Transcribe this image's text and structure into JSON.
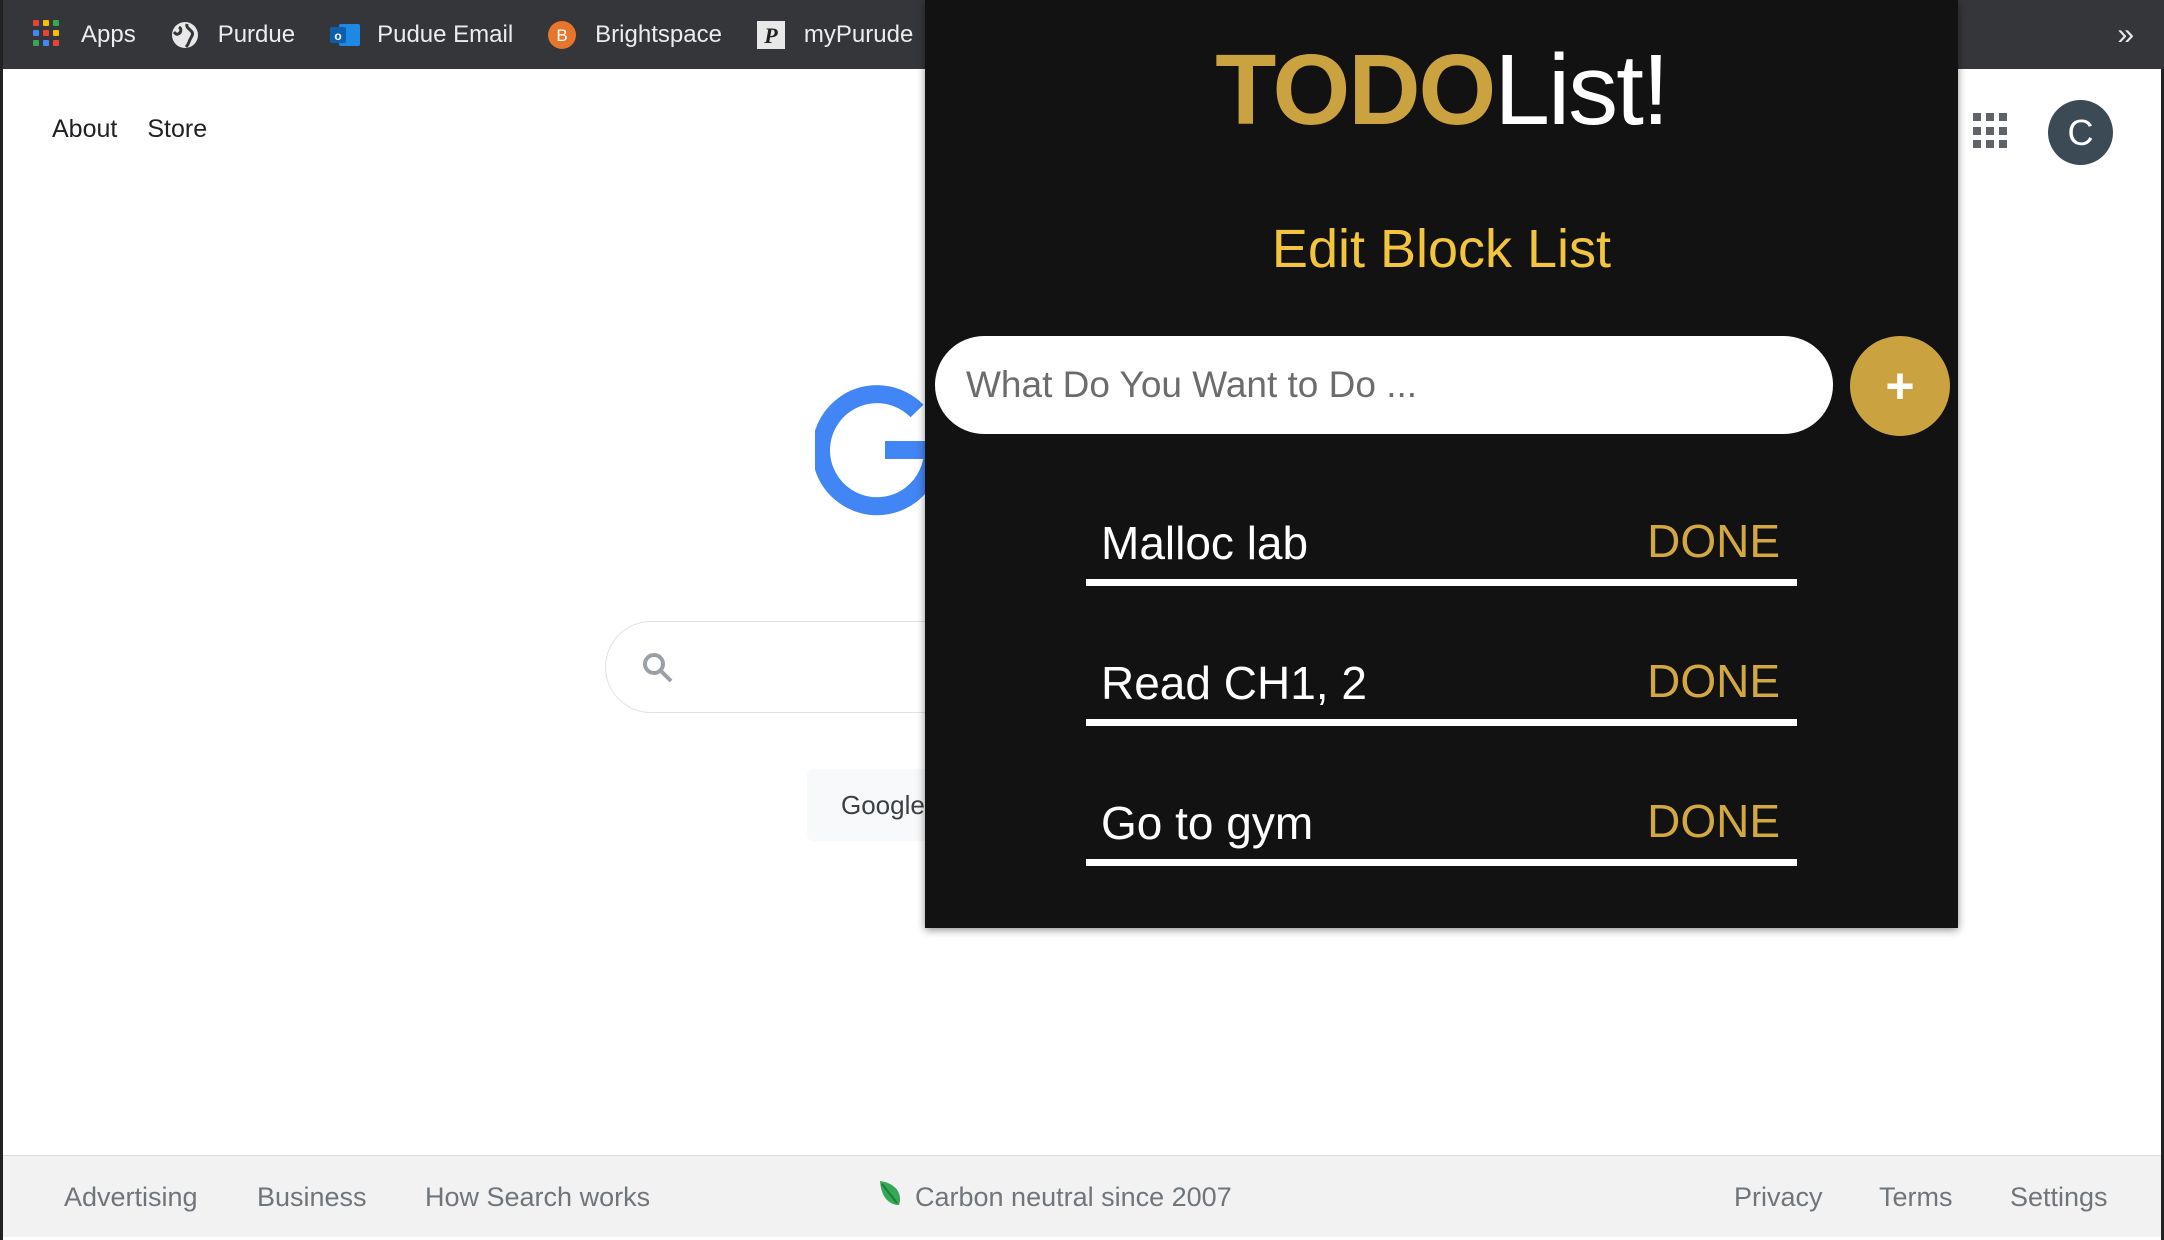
{
  "bookmarks": {
    "items": [
      {
        "label": "Apps"
      },
      {
        "label": "Purdue"
      },
      {
        "label": "Pudue Email"
      },
      {
        "label": "Brightspace"
      },
      {
        "label": "myPurude"
      }
    ],
    "overflow": "»"
  },
  "google": {
    "top_links": [
      "About",
      "Store"
    ],
    "avatar_letter": "C",
    "search_button": "Google",
    "footer": {
      "left": [
        "Advertising",
        "Business",
        "How Search works"
      ],
      "carbon": "Carbon neutral since 2007",
      "right": [
        "Privacy",
        "Terms",
        "Settings"
      ]
    }
  },
  "todo": {
    "title_bold": "TODO",
    "title_rest": "List!",
    "edit_block_label": "Edit Block List",
    "input_placeholder": "What Do You Want to Do ...",
    "add_label": "+",
    "tasks": [
      {
        "name": "Malloc lab",
        "action": "DONE"
      },
      {
        "name": "Read CH1, 2",
        "action": "DONE"
      },
      {
        "name": "Go to gym",
        "action": "DONE"
      }
    ]
  },
  "colors": {
    "accent_gold": "#caa240",
    "edit_yellow": "#f2c53c",
    "popup_bg": "#121212",
    "bookmarks_bg": "#35363a"
  }
}
